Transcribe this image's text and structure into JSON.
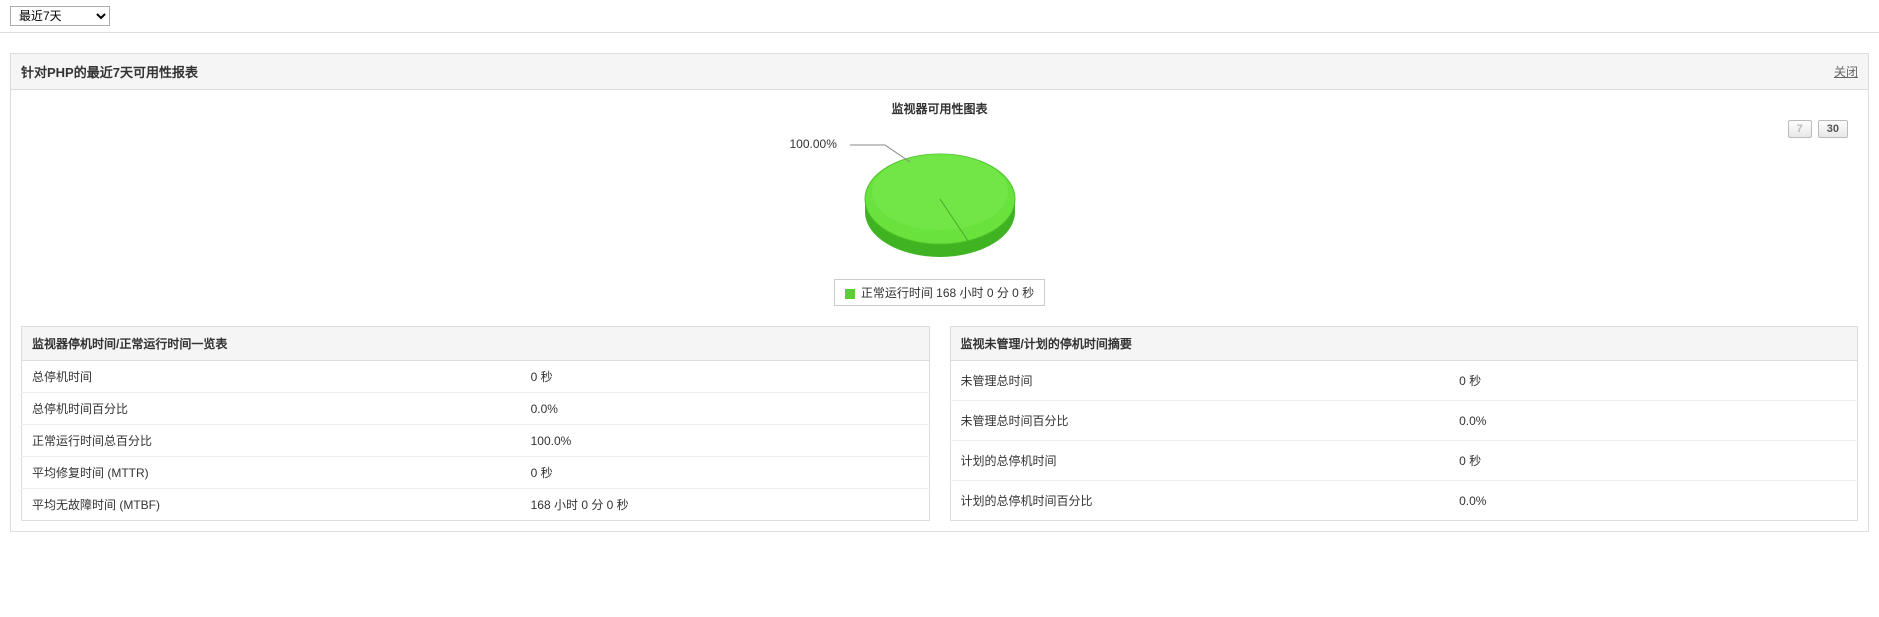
{
  "timeRange": {
    "selected": "最近7天"
  },
  "panel": {
    "title": "针对PHP的最近7天可用性报表",
    "closeLabel": "关闭"
  },
  "chart": {
    "title": "监视器可用性图表",
    "pctLabel": "100.00%",
    "rangeBtn7": "7",
    "rangeBtn30": "30",
    "legendText": "正常运行时间 168 小时 0 分 0 秒"
  },
  "chart_data": {
    "type": "pie",
    "title": "监视器可用性图表",
    "categories": [
      "正常运行时间"
    ],
    "values": [
      100.0
    ],
    "series": [
      {
        "name": "正常运行时间 168 小时 0 分 0 秒",
        "value": 100.0,
        "color": "#5bce36"
      }
    ],
    "annotations": [
      "100.00%"
    ]
  },
  "leftTable": {
    "header": "监视器停机时间/正常运行时间一览表",
    "rows": [
      {
        "label": "总停机时间",
        "value": "0 秒"
      },
      {
        "label": "总停机时间百分比",
        "value": "0.0%"
      },
      {
        "label": "正常运行时间总百分比",
        "value": "100.0%"
      },
      {
        "label": "平均修复时间 (MTTR)",
        "value": "0 秒"
      },
      {
        "label": "平均无故障时间 (MTBF)",
        "value": "168 小时 0 分 0 秒"
      }
    ]
  },
  "rightTable": {
    "header": "监视未管理/计划的停机时间摘要",
    "rows": [
      {
        "label": "未管理总时间",
        "value": "0 秒"
      },
      {
        "label": "未管理总时间百分比",
        "value": "0.0%"
      },
      {
        "label": "计划的总停机时间",
        "value": "0 秒"
      },
      {
        "label": "计划的总停机时间百分比",
        "value": "0.0%"
      }
    ]
  }
}
